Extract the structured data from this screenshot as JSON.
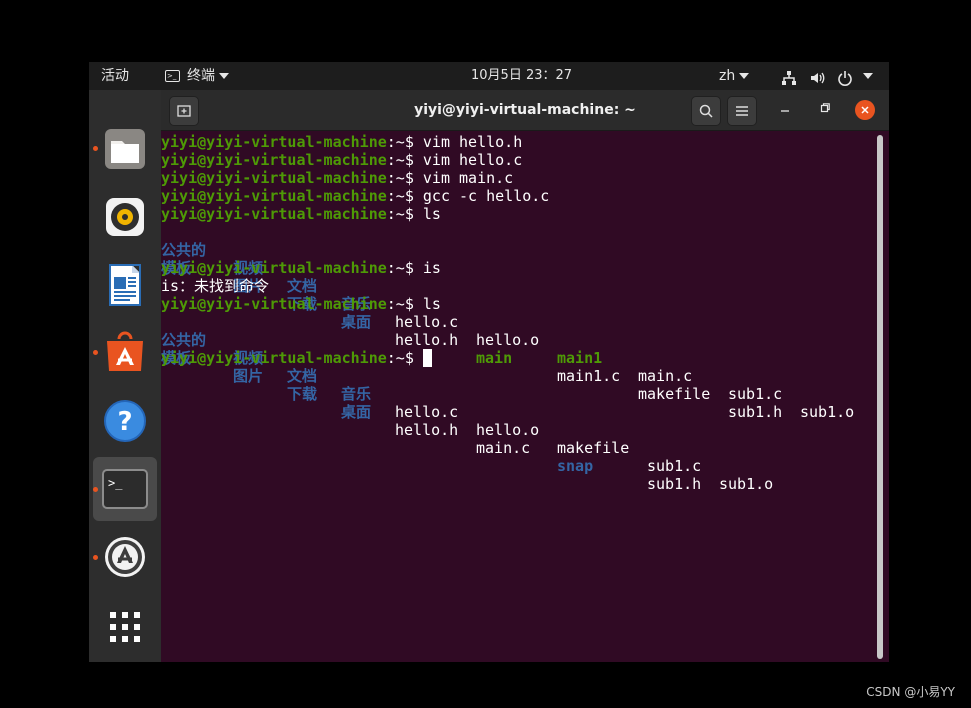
{
  "topbar": {
    "activities": "活动",
    "app_menu": "终端",
    "clock": "10月5日  23：27",
    "language": "zh"
  },
  "dock": {
    "apps": [
      "files",
      "rhythmbox",
      "libreoffice-writer",
      "ubuntu-software",
      "help",
      "terminal",
      "software-updater",
      "show-applications"
    ]
  },
  "window": {
    "title": "yiyi@yiyi-virtual-machine: ~"
  },
  "terminal": {
    "prompt": "yiyi@yiyi-virtual-machine",
    "path": ":~$ ",
    "commands": [
      "vim hello.h",
      "vim hello.c",
      "vim main.c",
      "gcc -c hello.c",
      "ls",
      "is",
      "ls"
    ],
    "ls1": {
      "row1": [
        "公共的",
        "视频",
        "文档",
        "音乐",
        "hello.c",
        "hello.o",
        "main1",
        "main.c",
        "sub1.c",
        "sub1.o"
      ],
      "row2": [
        "模板",
        "图片",
        "下载",
        "桌面",
        "hello.h",
        "main",
        "main1.c",
        "makefile",
        "sub1.h"
      ]
    },
    "error": "is：未找到命令",
    "ls2": {
      "row1": [
        "公共的",
        "视频",
        "文档",
        "音乐",
        "hello.c",
        "hello.o",
        "makefile",
        "sub1.c",
        "sub1.o"
      ],
      "row2": [
        "模板",
        "图片",
        "下载",
        "桌面",
        "hello.h",
        "main.c",
        "snap",
        "sub1.h"
      ]
    }
  },
  "watermark": "CSDN @小易YY",
  "colors": {
    "terminal_bg": "#300a24",
    "prompt_green": "#4e9a06",
    "dir_blue": "#3465a4",
    "ubuntu_orange": "#e95420"
  }
}
